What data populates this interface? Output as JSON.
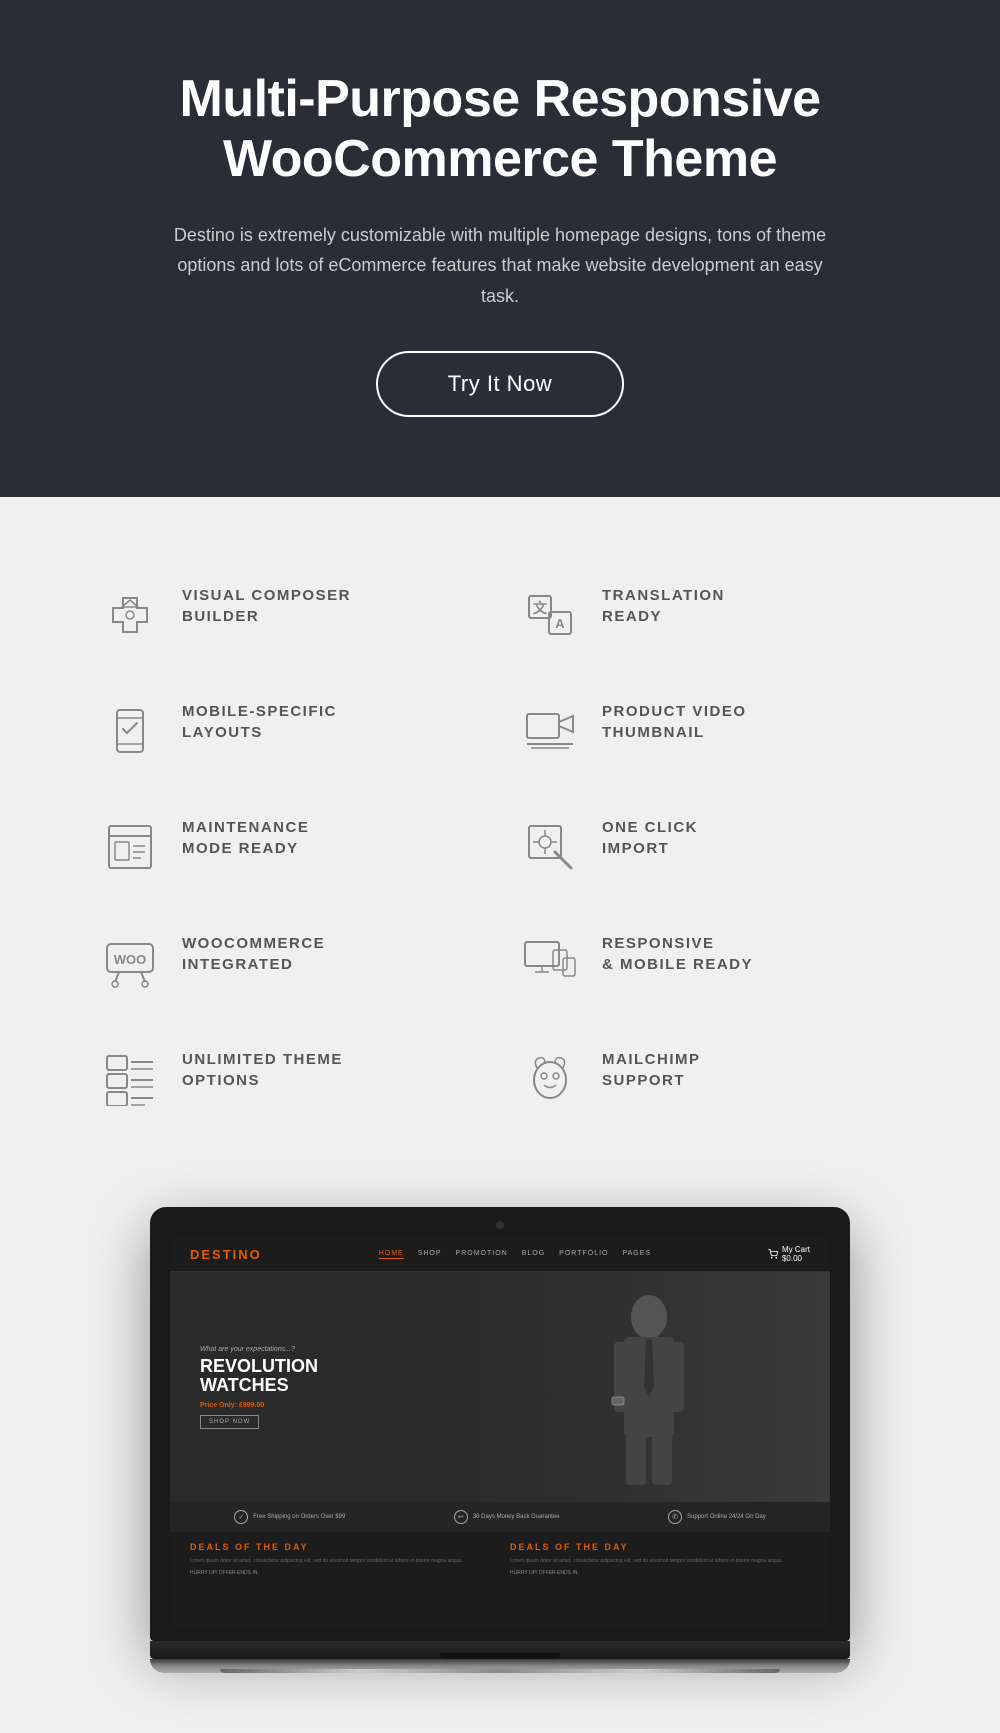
{
  "hero": {
    "title_line1": "Multi-Purpose Responsive",
    "title_line2": "WooCommerce Theme",
    "description": "Destino is extremely customizable with multiple homepage designs, tons of theme options and lots of eCommerce features that make website development an easy task.",
    "cta_label": "Try It Now"
  },
  "features": {
    "items": [
      {
        "id": "visual-composer",
        "label": "VISUAL COMPOSER\nBUILDER",
        "icon": "puzzle"
      },
      {
        "id": "translation-ready",
        "label": "TRANSLATION\nREADY",
        "icon": "translate"
      },
      {
        "id": "mobile-layouts",
        "label": "MOBILE-SPECIFIC\nLAYOUTS",
        "icon": "mobile"
      },
      {
        "id": "product-video",
        "label": "PRODUCT VIDEO\nTHUMBNAIL",
        "icon": "video"
      },
      {
        "id": "maintenance",
        "label": "MAINTENANCE\nMODE READY",
        "icon": "maintenance"
      },
      {
        "id": "one-click",
        "label": "ONE CLICK\nIMPORT",
        "icon": "click"
      },
      {
        "id": "woocommerce",
        "label": "WOOCOMMERCE\nINTEGRATED",
        "icon": "woo"
      },
      {
        "id": "responsive",
        "label": "RESPONSIVE\n& MOBILE READY",
        "icon": "responsive"
      },
      {
        "id": "unlimited-theme",
        "label": "UNLIMITED THEME\nOPTIONS",
        "icon": "theme"
      },
      {
        "id": "mailchimp",
        "label": "MAILCHIMP\nSUPPORT",
        "icon": "mail"
      }
    ]
  },
  "laptop": {
    "logo": "DESTIN",
    "logo_accent": "O",
    "nav_links": [
      "HOME",
      "SHOP",
      "PROMOTION",
      "BLOG",
      "PORTFOLIO",
      "PAGES"
    ],
    "hero_subtitle": "What are your expectations...?",
    "hero_title_line1": "REVOLUTION",
    "hero_title_line2": "WATCHES",
    "hero_price_label": "Price Only:",
    "hero_price": "£999.00",
    "hero_cta": "SHOP NOW",
    "promo_items": [
      "Free Shipping on Orders Over $99",
      "30 Days Money Back Guarantee",
      "Support Online 24/24 On Day"
    ],
    "deals_title": "DEALS OF THE DAY",
    "deals_text": "Lorem ipsum dolor sit amet, consectetur adipiscing elit, sed do eiusmod tempor incididunt ut labore et dolore magna aliqua.",
    "deals_hurry": "HURRY UP! OFFER ENDS IN:"
  }
}
